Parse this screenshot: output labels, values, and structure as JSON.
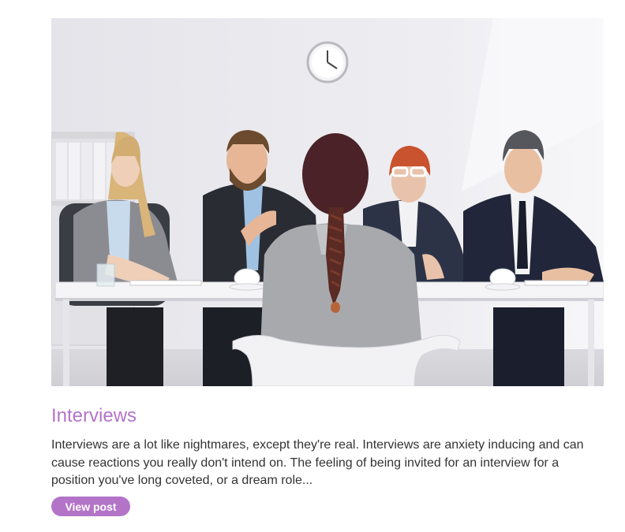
{
  "post": {
    "image_alt": "Interview panel of four seated at a white table facing a woman with a braid sitting in a white chair",
    "title": "Interviews",
    "excerpt": "Interviews are a lot like nightmares, except they're real. Interviews are anxiety inducing and can cause reactions you really don't intend on. The feeling of being invited for an interview for a position you've long coveted, or a dream role...",
    "button_label": "View post"
  },
  "colors": {
    "accent": "#b374c8",
    "text": "#333333",
    "background": "#ffffff"
  }
}
